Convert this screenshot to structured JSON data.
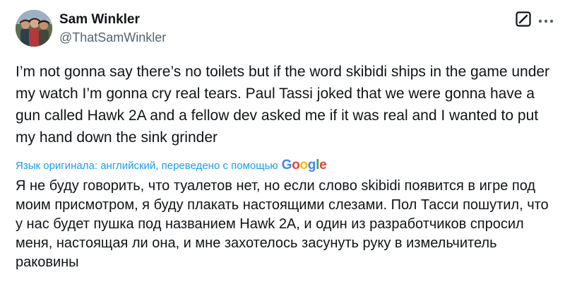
{
  "author": {
    "name": "Sam Winkler",
    "handle": "@ThatSamWinkler"
  },
  "tweet": {
    "text": "I’m not gonna say there’s no toilets but if the word skibidi ships in the game under my watch I’m gonna cry real tears. Paul Tassi joked that we were gonna have a gun called Hawk 2A and a fellow dev asked me if it was real and I wanted to put my hand down the sink grinder"
  },
  "translation": {
    "note": "Язык оригинала: английский, переведено с помощью",
    "provider": "Google",
    "text": "Я не буду говорить, что туалетов нет, но если слово skibidi появится в игре под моим присмотром, я буду плакать настоящими слезами. Пол Тасси пошутил, что у нас будет пушка под названием Hawk 2A, и один из разработчиков спросил меня, настоящая ли она, и мне захотелось засунуть руку в измельчитель раковины"
  },
  "icons": {
    "avatar": "avatar-photo",
    "grok": "grok-icon",
    "more": "more-icon"
  },
  "colors": {
    "text": "#0f1419",
    "secondary": "#536471",
    "link": "#1d9bf0",
    "google_blue": "#4285f4",
    "google_red": "#ea4335",
    "google_yellow": "#fbbc05",
    "google_green": "#34a853"
  }
}
